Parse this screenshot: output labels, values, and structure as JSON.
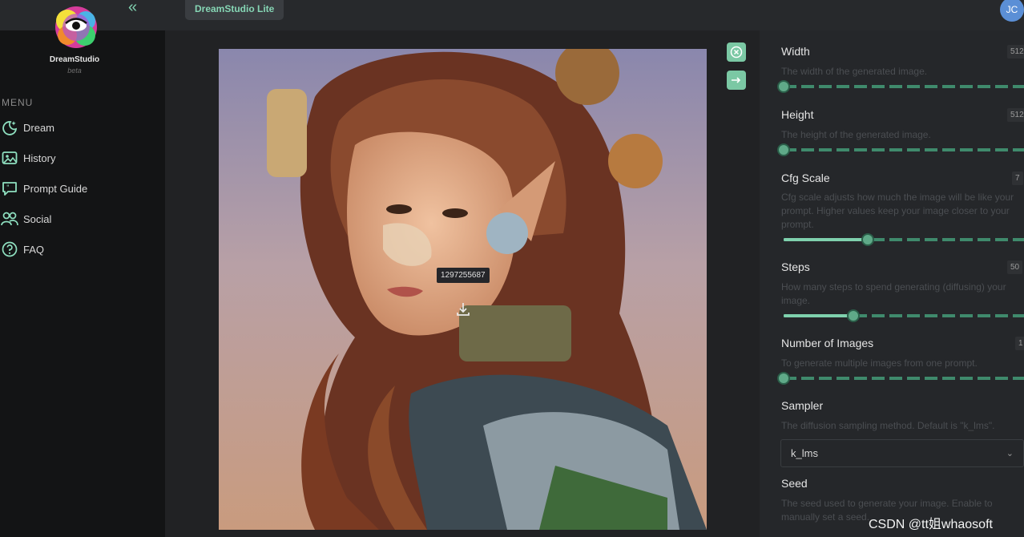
{
  "header": {
    "app_tab": "DreamStudio Lite",
    "collapse_icon": "double-chevron-left-icon",
    "user_initials": "JC"
  },
  "sidebar": {
    "brand_name": "DreamStudio",
    "brand_sub": "beta",
    "menu_heading": "MENU",
    "items": [
      {
        "label": "Dream",
        "icon": "moon-sparkle-icon"
      },
      {
        "label": "History",
        "icon": "image-gallery-icon"
      },
      {
        "label": "Prompt Guide",
        "icon": "speech-bubble-icon"
      },
      {
        "label": "Social",
        "icon": "people-icon"
      },
      {
        "label": "FAQ",
        "icon": "question-circle-icon"
      }
    ]
  },
  "image": {
    "seed_tooltip": "1297255687",
    "download_icon": "download-icon",
    "close_icon": "close-circle-icon",
    "expand_icon": "arrow-right-icon"
  },
  "settings": {
    "width": {
      "label": "Width",
      "value": "512",
      "description": "The width of the generated image.",
      "level": 0
    },
    "height": {
      "label": "Height",
      "value": "512",
      "description": "The height of the generated image.",
      "level": 0
    },
    "cfg": {
      "label": "Cfg Scale",
      "value": "7",
      "description": "Cfg scale adjusts how much the image will be like your prompt. Higher values keep your image closer to your prompt.",
      "level": 0.35
    },
    "steps": {
      "label": "Steps",
      "value": "50",
      "description": "How many steps to spend generating (diffusing) your image.",
      "level": 0.29
    },
    "num_images": {
      "label": "Number of Images",
      "value": "1",
      "description": "To generate multiple images from one prompt.",
      "level": 0
    },
    "sampler": {
      "label": "Sampler",
      "description": "The diffusion sampling method. Default is \"k_lms\".",
      "value": "k_lms"
    },
    "seed": {
      "label": "Seed",
      "description": "The seed used to generate your image. Enable to manually set a seed."
    }
  },
  "watermark": "CSDN @tt姐whaosoft",
  "colors": {
    "accent": "#7fd1ad",
    "background": "#212224",
    "sidebar": "#131415"
  }
}
